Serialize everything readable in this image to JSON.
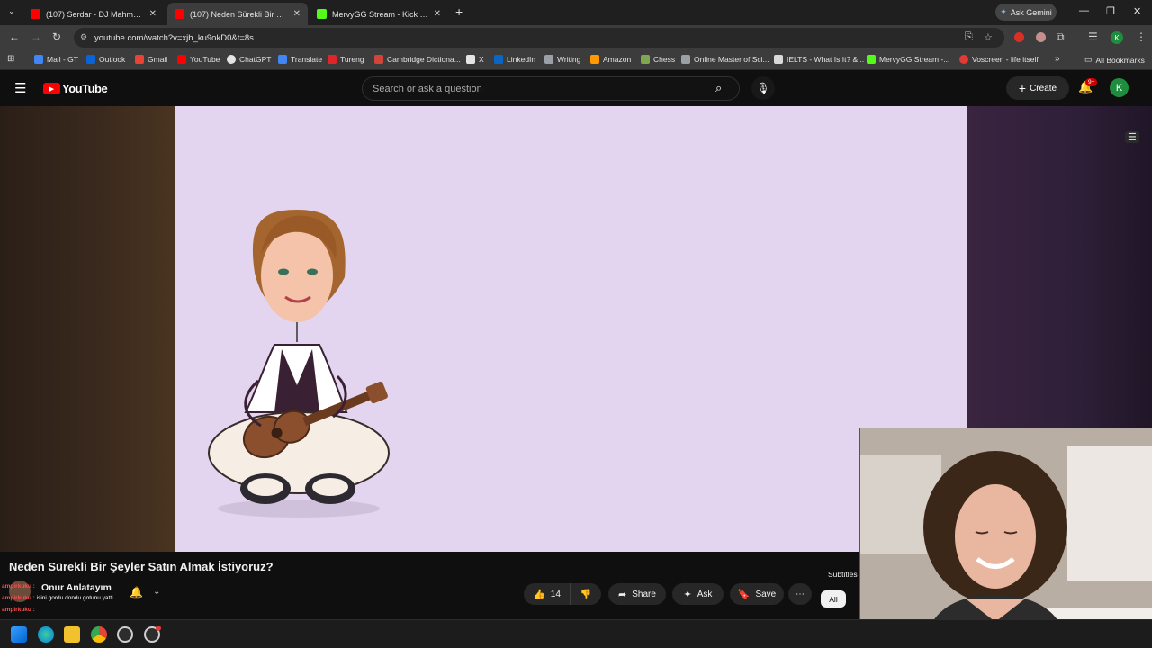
{
  "tabs": [
    {
      "title": "(107) Serdar - DJ Mahmut Deg",
      "close": "✕"
    },
    {
      "title": "(107) Neden Sürekli Bir Şeyler S",
      "close": "✕"
    },
    {
      "title": "MervyGG Stream - Kick Dashbo",
      "close": "✕"
    }
  ],
  "new_tab": "+",
  "ask_gemini": "Ask Gemini",
  "window": {
    "min": "—",
    "max": "❐",
    "close": "✕"
  },
  "address": {
    "url": "youtube.com/watch?v=xjb_ku9okD0&t=8s"
  },
  "bookmarks": [
    {
      "label": "Mail - GT",
      "color": "#4285f4"
    },
    {
      "label": "Outlook",
      "color": "#0a64d6"
    },
    {
      "label": "Gmail",
      "color": "#ea4335"
    },
    {
      "label": "YouTube",
      "color": "#ff0000"
    },
    {
      "label": "ChatGPT",
      "color": "#e5e5e5"
    },
    {
      "label": "Translate",
      "color": "#4285f4"
    },
    {
      "label": "Tureng",
      "color": "#e0242a"
    },
    {
      "label": "Cambridge Dictiona...",
      "color": "#d0443a"
    },
    {
      "label": "X",
      "color": "#e5e5e5"
    },
    {
      "label": "LinkedIn",
      "color": "#0a66c2"
    },
    {
      "label": "Writing",
      "color": "#9aa0a6"
    },
    {
      "label": "Amazon",
      "color": "#ff9900"
    },
    {
      "label": "Chess",
      "color": "#7fa650"
    },
    {
      "label": "Online Master of Sci...",
      "color": "#9aa0a6"
    },
    {
      "label": "IELTS - What Is It? &...",
      "color": "#d9d9d9"
    },
    {
      "label": "MervyGG Stream -...",
      "color": "#53fc18"
    },
    {
      "label": "Voscreen - life itself",
      "color": "#e53935"
    }
  ],
  "all_bookmarks": "All Bookmarks",
  "youtube": {
    "logo": "YouTube",
    "search_placeholder": "Search or ask a question",
    "create": "Create",
    "notif_badge": "9+",
    "avatar": "K"
  },
  "video": {
    "title": "Neden Sürekli Bir Şeyler Satın Almak İstiyoruz?",
    "channel": "Onur Anlatayım",
    "likes": "14",
    "share": "Share",
    "ask": "Ask",
    "save": "Save",
    "subtitles": "Subtitles",
    "filter_all": "All"
  },
  "chat": [
    {
      "user": "ampirkuku :",
      "msg": ""
    },
    {
      "user": "ampirkuku :",
      "msg": "isini gordu dondu gotunu yatti"
    },
    {
      "user": "ampirkuku :",
      "msg": ""
    }
  ],
  "colors": {
    "yt_red": "#ff0000",
    "frame_bg": "#e3d5ef",
    "avatar_green": "#1e8e3e"
  }
}
